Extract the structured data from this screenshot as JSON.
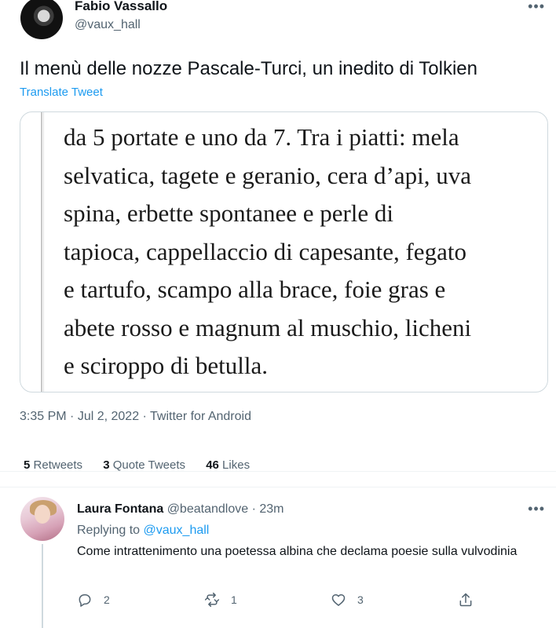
{
  "tweet": {
    "author_name": "Fabio Vassallo",
    "author_handle": "@vaux_hall",
    "more_icon": "more-horizontal-icon",
    "text": "Il menù delle nozze Pascale-Turci, un inedito di Tolkien",
    "translate_label": "Translate Tweet",
    "media_text_lines": [
      "da 5 portate e uno da 7. Tra i piatti: mela",
      "selvatica, tagete e geranio, cera d’api, uva",
      "spina, erbette spontanee e perle di",
      "tapioca, cappellaccio di capesante, fegato",
      "e tartufo, scampo alla brace, foie gras e",
      "abete rosso e magnum al muschio, licheni",
      "e sciroppo di betulla."
    ],
    "time": "3:35 PM",
    "date": "Jul 2, 2022",
    "source": "Twitter for Android",
    "separator": " · ",
    "stats": {
      "retweets_count": "5",
      "retweets_label": "Retweets",
      "quotes_count": "3",
      "quotes_label": "Quote Tweets",
      "likes_count": "46",
      "likes_label": "Likes"
    }
  },
  "reply": {
    "author_name": "Laura Fontana",
    "author_handle": "@beatandlove",
    "dot": "·",
    "time": "23m",
    "replying_to_label": "Replying to",
    "replying_to_handle": "@vaux_hall",
    "text": "Come intrattenimento una poetessa albina che declama poesie sulla vulvodinia",
    "actions": {
      "reply_count": "2",
      "retweet_count": "1",
      "like_count": "3",
      "share_count": ""
    }
  },
  "colors": {
    "accent": "#1d9bf0",
    "secondary_text": "#536471",
    "primary_text": "#0f1419",
    "border": "#cfd9de"
  }
}
